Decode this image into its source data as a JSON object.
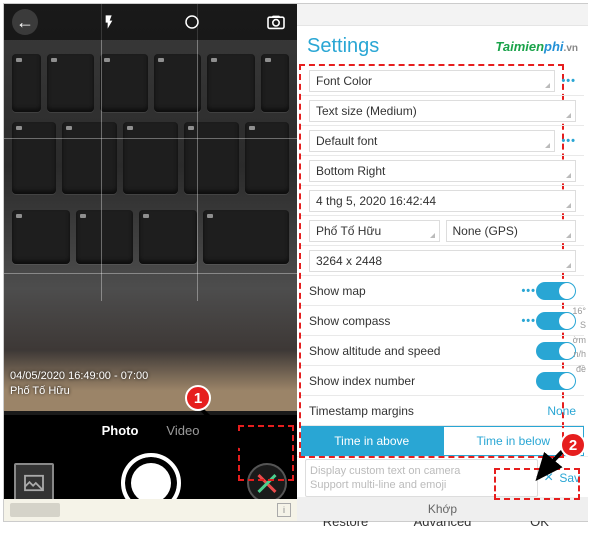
{
  "camera": {
    "watermark_line1": "04/05/2020 16:49:00 - 07:00",
    "watermark_line2": "Phố Tố Hữu",
    "mode_photo": "Photo",
    "mode_video": "Video"
  },
  "settings": {
    "title": "Settings",
    "logo_part1": "Taimien",
    "logo_part2": "phi",
    "logo_vn": ".vn",
    "font_color": "Font Color",
    "text_size": "Text size (Medium)",
    "default_font": "Default font",
    "bottom_right": "Bottom Right",
    "timestamp": "4 thg 5, 2020 16:42:44",
    "location_name": "Phố Tố Hữu",
    "gps_value": "None (GPS)",
    "resolution": "3264 x 2448",
    "show_map": "Show map",
    "show_compass": "Show compass",
    "show_alt_speed": "Show altitude and speed",
    "show_index": "Show index number",
    "ts_margins": "Timestamp margins",
    "ts_margins_val": "None",
    "time_above": "Time in above",
    "time_below": "Time in below",
    "custom_text": "Display custom text on camera\nSupport multi-line and emoji",
    "save": "Sav",
    "restore": "Restore",
    "advanced": "Advanced",
    "ok": "OK",
    "footer": "Khớp"
  },
  "side": {
    "l1": "16°",
    "l2": "S",
    "l3": "ờm",
    "l4": "n/h",
    "l5": "đề"
  },
  "callouts": {
    "one": "1",
    "two": "2"
  }
}
